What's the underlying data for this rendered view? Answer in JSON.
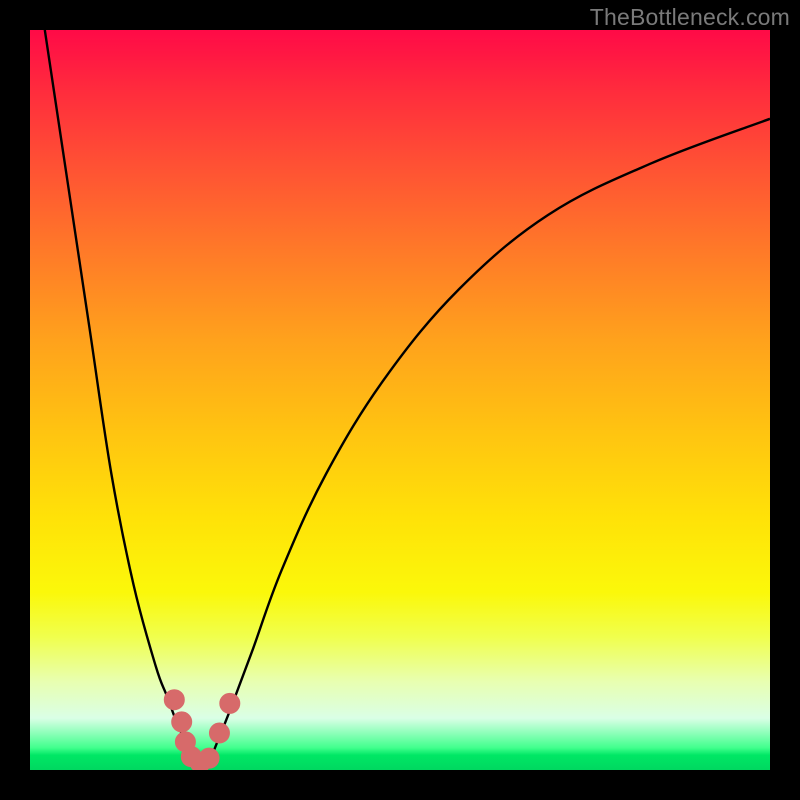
{
  "watermark": "TheBottleneck.com",
  "colors": {
    "frame": "#000000",
    "curve": "#000000",
    "marker_fill": "#d76a6a",
    "marker_stroke": "#d76a6a"
  },
  "chart_data": {
    "type": "line",
    "title": "",
    "xlabel": "",
    "ylabel": "",
    "xlim": [
      0,
      100
    ],
    "ylim": [
      0,
      100
    ],
    "grid": false,
    "series": [
      {
        "name": "left-branch",
        "x": [
          2,
          5,
          8,
          11,
          14,
          17,
          18.5,
          20,
          21,
          22,
          23
        ],
        "y": [
          100,
          80,
          60,
          40,
          25,
          14,
          10,
          6,
          4,
          2,
          0.5
        ]
      },
      {
        "name": "right-branch",
        "x": [
          24,
          25,
          27,
          30,
          34,
          40,
          48,
          58,
          70,
          84,
          100
        ],
        "y": [
          0.5,
          3,
          8,
          16,
          27,
          40,
          53,
          65,
          75,
          82,
          88
        ]
      }
    ],
    "markers": [
      {
        "x": 19.5,
        "y": 9.5
      },
      {
        "x": 20.5,
        "y": 6.5
      },
      {
        "x": 21.0,
        "y": 3.8
      },
      {
        "x": 21.8,
        "y": 1.8
      },
      {
        "x": 23.0,
        "y": 1.0
      },
      {
        "x": 24.2,
        "y": 1.6
      },
      {
        "x": 25.6,
        "y": 5.0
      },
      {
        "x": 27.0,
        "y": 9.0
      }
    ],
    "marker_radius": 10
  }
}
